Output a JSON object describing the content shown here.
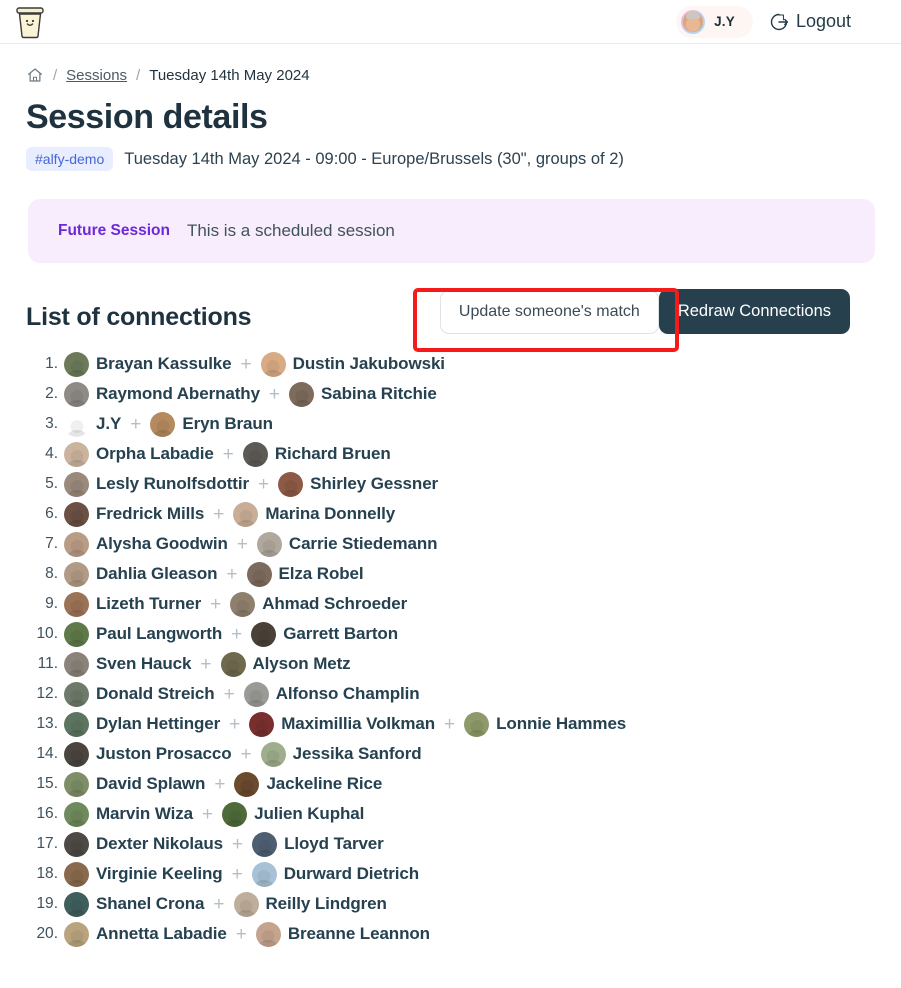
{
  "topbar": {
    "logo_name": "coffee-cup-logo",
    "user_chip": {
      "name": "J.Y",
      "avatar": "user-avatar"
    },
    "logout": {
      "label": "Logout",
      "icon": "logout-icon"
    }
  },
  "breadcrumb": {
    "home_icon": "home-icon",
    "separator": "/",
    "items": [
      {
        "label": "Sessions",
        "link": true
      },
      {
        "label": "Tuesday 14th May 2024",
        "link": false
      }
    ]
  },
  "header": {
    "title": "Session details",
    "tag": "#alfy-demo",
    "meta": "Tuesday 14th May 2024 - 09:00 - Europe/Brussels (30\", groups of 2)"
  },
  "banner": {
    "title": "Future Session",
    "text": "This is a scheduled session"
  },
  "section": {
    "title": "List of connections",
    "update_button": "Update someone's match",
    "redraw_button": "Redraw Connections"
  },
  "colors": {
    "accent_dark": "#26404e",
    "banner_bg": "#f8edfd",
    "banner_title": "#6d28d9",
    "tag_bg": "#e8eeff",
    "tag_text": "#4765d8",
    "highlight": "#f61a1a",
    "text_primary": "#1e333f"
  },
  "connections": [
    {
      "index": "1.",
      "people": [
        "Brayan Kassulke",
        "Dustin Jakubowski"
      ],
      "avatars": [
        "#6d7a5a",
        "#d9ab84"
      ]
    },
    {
      "index": "2.",
      "people": [
        "Raymond Abernathy",
        "Sabina Ritchie"
      ],
      "avatars": [
        "#8e8a85",
        "#7d6b5c"
      ]
    },
    {
      "index": "3.",
      "people": [
        "J.Y",
        "Eryn Braun"
      ],
      "avatars": [
        "ring",
        "#b58a5e"
      ]
    },
    {
      "index": "4.",
      "people": [
        "Orpha Labadie",
        "Richard Bruen"
      ],
      "avatars": [
        "#cbb49d",
        "#5e5b57"
      ]
    },
    {
      "index": "5.",
      "people": [
        "Lesly Runolfsdottir",
        "Shirley Gessner"
      ],
      "avatars": [
        "#9a8a7c",
        "#8d5a45"
      ]
    },
    {
      "index": "6.",
      "people": [
        "Fredrick Mills",
        "Marina Donnelly"
      ],
      "avatars": [
        "#6b5043",
        "#c9ae97"
      ]
    },
    {
      "index": "7.",
      "people": [
        "Alysha Goodwin",
        "Carrie Stiedemann"
      ],
      "avatars": [
        "#b99c86",
        "#b0a89c"
      ]
    },
    {
      "index": "8.",
      "people": [
        "Dahlia Gleason",
        "Elza Robel"
      ],
      "avatars": [
        "#b29a84",
        "#7c6a5c"
      ]
    },
    {
      "index": "9.",
      "people": [
        "Lizeth Turner",
        "Ahmad Schroeder"
      ],
      "avatars": [
        "#9c7257",
        "#8f7f6d"
      ]
    },
    {
      "index": "10.",
      "people": [
        "Paul Langworth",
        "Garrett Barton"
      ],
      "avatars": [
        "#5f7a4a",
        "#4a4238"
      ]
    },
    {
      "index": "11.",
      "people": [
        "Sven Hauck",
        "Alyson Metz"
      ],
      "avatars": [
        "#8a8379",
        "#6f6a4e"
      ]
    },
    {
      "index": "12.",
      "people": [
        "Donald Streich",
        "Alfonso Champlin"
      ],
      "avatars": [
        "#6e7a6a",
        "#9a9a96"
      ]
    },
    {
      "index": "13.",
      "people": [
        "Dylan Hettinger",
        "Maximillia Volkman",
        "Lonnie Hammes"
      ],
      "avatars": [
        "#5c7560",
        "#7a2f2f",
        "#8e9a6a"
      ]
    },
    {
      "index": "14.",
      "people": [
        "Juston Prosacco",
        "Jessika Sanford"
      ],
      "avatars": [
        "#4b4540",
        "#9fae8c"
      ]
    },
    {
      "index": "15.",
      "people": [
        "David Splawn",
        "Jackeline Rice"
      ],
      "avatars": [
        "#7e8e68",
        "#6b4a2e"
      ]
    },
    {
      "index": "16.",
      "people": [
        "Marvin Wiza",
        "Julien Kuphal"
      ],
      "avatars": [
        "#6f8a5c",
        "#4e6b3a"
      ]
    },
    {
      "index": "17.",
      "people": [
        "Dexter Nikolaus",
        "Lloyd Tarver"
      ],
      "avatars": [
        "#4d4a46",
        "#4f5f72"
      ]
    },
    {
      "index": "18.",
      "people": [
        "Virginie Keeling",
        "Durward Dietrich"
      ],
      "avatars": [
        "#8a6a4e",
        "#a7c2d6"
      ]
    },
    {
      "index": "19.",
      "people": [
        "Shanel Crona",
        "Reilly Lindgren"
      ],
      "avatars": [
        "#3f5f5c",
        "#bfae9a"
      ]
    },
    {
      "index": "20.",
      "people": [
        "Annetta Labadie",
        "Breanne Leannon"
      ],
      "avatars": [
        "#b9a47e",
        "#c4a48e"
      ]
    }
  ]
}
